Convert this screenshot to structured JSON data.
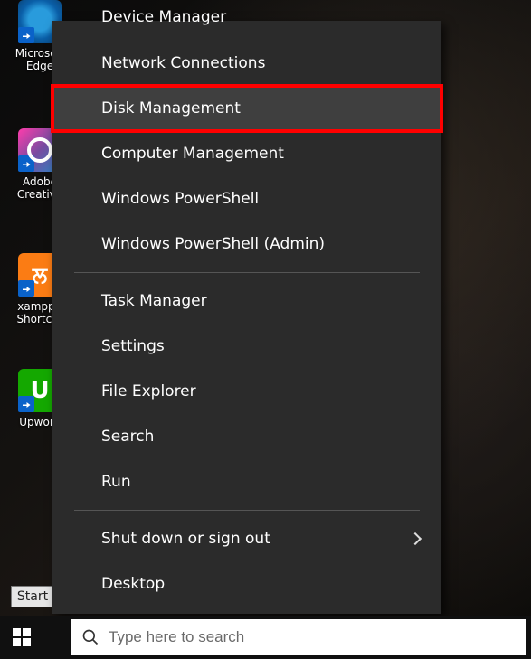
{
  "desktop": {
    "icons": [
      {
        "label": "Microsoft Edge"
      },
      {
        "label": "Adobe Creative"
      },
      {
        "label": "xampp - Shortcut",
        "glyph": "ਲ"
      },
      {
        "label": "Upwork",
        "glyph": "U"
      }
    ]
  },
  "start_hint": {
    "label": "Start"
  },
  "taskbar": {
    "search_placeholder": "Type here to search"
  },
  "winx_menu": {
    "items": [
      {
        "label": "Device Manager",
        "cut": true
      },
      {
        "label": "Network Connections"
      },
      {
        "label": "Disk Management",
        "highlight": true,
        "hover": true
      },
      {
        "label": "Computer Management"
      },
      {
        "label": "Windows PowerShell"
      },
      {
        "label": "Windows PowerShell (Admin)"
      },
      {
        "sep": true
      },
      {
        "label": "Task Manager"
      },
      {
        "label": "Settings"
      },
      {
        "label": "File Explorer"
      },
      {
        "label": "Search"
      },
      {
        "label": "Run"
      },
      {
        "sep": true
      },
      {
        "label": "Shut down or sign out",
        "submenu": true
      },
      {
        "label": "Desktop"
      }
    ]
  },
  "colors": {
    "highlight": "#ff0000",
    "menu_bg": "#2b2b2b"
  }
}
